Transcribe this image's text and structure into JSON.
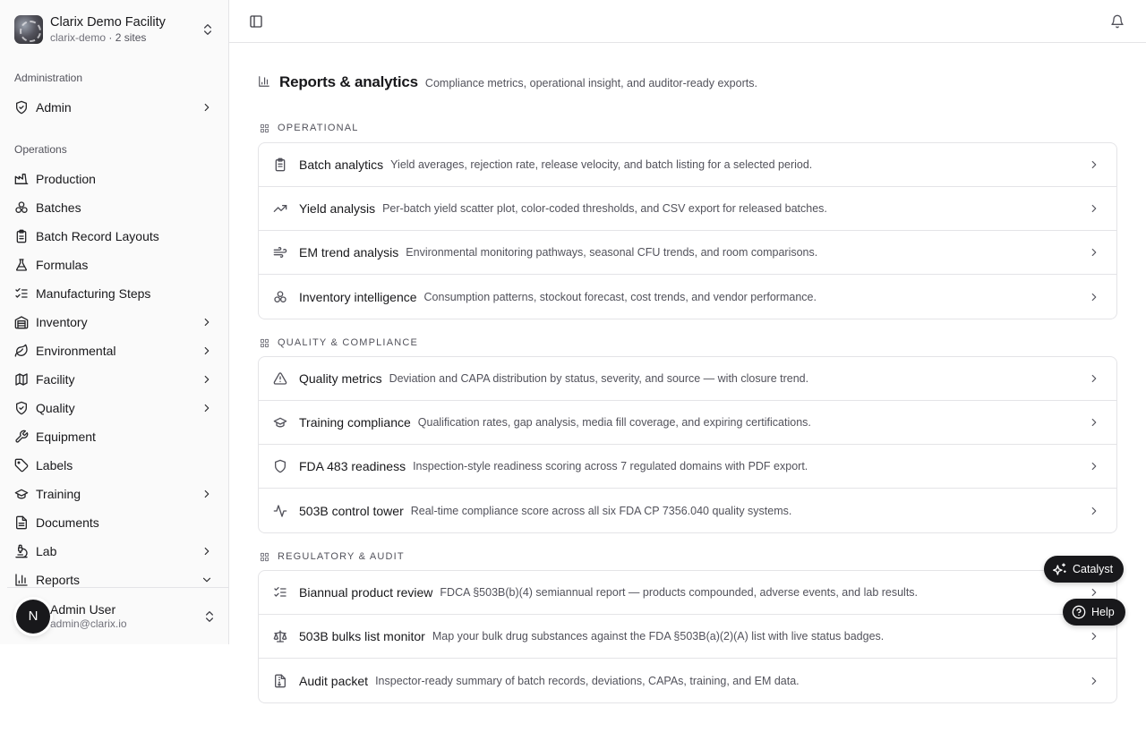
{
  "org": {
    "name": "Clarix Demo Facility",
    "slug": "clarix-demo",
    "sites": "· 2 sites"
  },
  "sidebar": {
    "admin_group": "Administration",
    "ops_group": "Operations",
    "items": [
      {
        "label": "Admin",
        "icon": "shield-check-icon",
        "chevron": "right"
      },
      {
        "label": "Production",
        "icon": "factory-icon"
      },
      {
        "label": "Batches",
        "icon": "boxes-icon"
      },
      {
        "label": "Batch Record Layouts",
        "icon": "clipboard-icon"
      },
      {
        "label": "Formulas",
        "icon": "flask-icon"
      },
      {
        "label": "Manufacturing Steps",
        "icon": "list-checks-icon"
      },
      {
        "label": "Inventory",
        "icon": "warehouse-icon",
        "chevron": "right"
      },
      {
        "label": "Environmental",
        "icon": "leaf-icon",
        "chevron": "right"
      },
      {
        "label": "Facility",
        "icon": "map-icon",
        "chevron": "right"
      },
      {
        "label": "Quality",
        "icon": "shield-check-icon",
        "chevron": "right"
      },
      {
        "label": "Equipment",
        "icon": "wrench-icon"
      },
      {
        "label": "Labels",
        "icon": "tag-icon"
      },
      {
        "label": "Training",
        "icon": "graduation-cap-icon",
        "chevron": "right"
      },
      {
        "label": "Documents",
        "icon": "file-text-icon"
      },
      {
        "label": "Lab",
        "icon": "microscope-icon",
        "chevron": "right"
      },
      {
        "label": "Reports",
        "icon": "bar-chart-icon",
        "chevron": "down"
      }
    ]
  },
  "user": {
    "initial": "N",
    "name": "Admin User",
    "email": "admin@clarix.io"
  },
  "page": {
    "title": "Reports & analytics",
    "description": "Compliance metrics, operational insight, and auditor-ready exports."
  },
  "sections": [
    {
      "label": "OPERATIONAL",
      "items": [
        {
          "title": "Batch analytics",
          "desc": "Yield averages, rejection rate, release velocity, and batch listing for a selected period.",
          "icon": "clipboard-list-icon"
        },
        {
          "title": "Yield analysis",
          "desc": "Per-batch yield scatter plot, color-coded thresholds, and CSV export for released batches.",
          "icon": "trending-up-icon"
        },
        {
          "title": "EM trend analysis",
          "desc": "Environmental monitoring pathways, seasonal CFU trends, and room comparisons.",
          "icon": "wind-icon"
        },
        {
          "title": "Inventory intelligence",
          "desc": "Consumption patterns, stockout forecast, cost trends, and vendor performance.",
          "icon": "boxes-icon"
        }
      ]
    },
    {
      "label": "QUALITY & COMPLIANCE",
      "items": [
        {
          "title": "Quality metrics",
          "desc": "Deviation and CAPA distribution by status, severity, and source — with closure trend.",
          "icon": "alert-triangle-icon"
        },
        {
          "title": "Training compliance",
          "desc": "Qualification rates, gap analysis, media fill coverage, and expiring certifications.",
          "icon": "graduation-cap-icon"
        },
        {
          "title": "FDA 483 readiness",
          "desc": "Inspection-style readiness scoring across 7 regulated domains with PDF export.",
          "icon": "shield-icon"
        },
        {
          "title": "503B control tower",
          "desc": "Real-time compliance score across all six FDA CP 7356.040 quality systems.",
          "icon": "activity-icon"
        }
      ]
    },
    {
      "label": "REGULATORY & AUDIT",
      "items": [
        {
          "title": "Biannual product review",
          "desc": "FDCA §503B(b)(4) semiannual report — products compounded, adverse events, and lab results.",
          "icon": "list-checks-icon"
        },
        {
          "title": "503B bulks list monitor",
          "desc": "Map your bulk drug substances against the FDA §503B(a)(2)(A) list with live status badges.",
          "icon": "scale-icon"
        },
        {
          "title": "Audit packet",
          "desc": "Inspector-ready summary of batch records, deviations, CAPAs, training, and EM data.",
          "icon": "file-archive-icon"
        }
      ]
    }
  ],
  "floating": {
    "catalyst": "Catalyst",
    "help": "Help"
  }
}
